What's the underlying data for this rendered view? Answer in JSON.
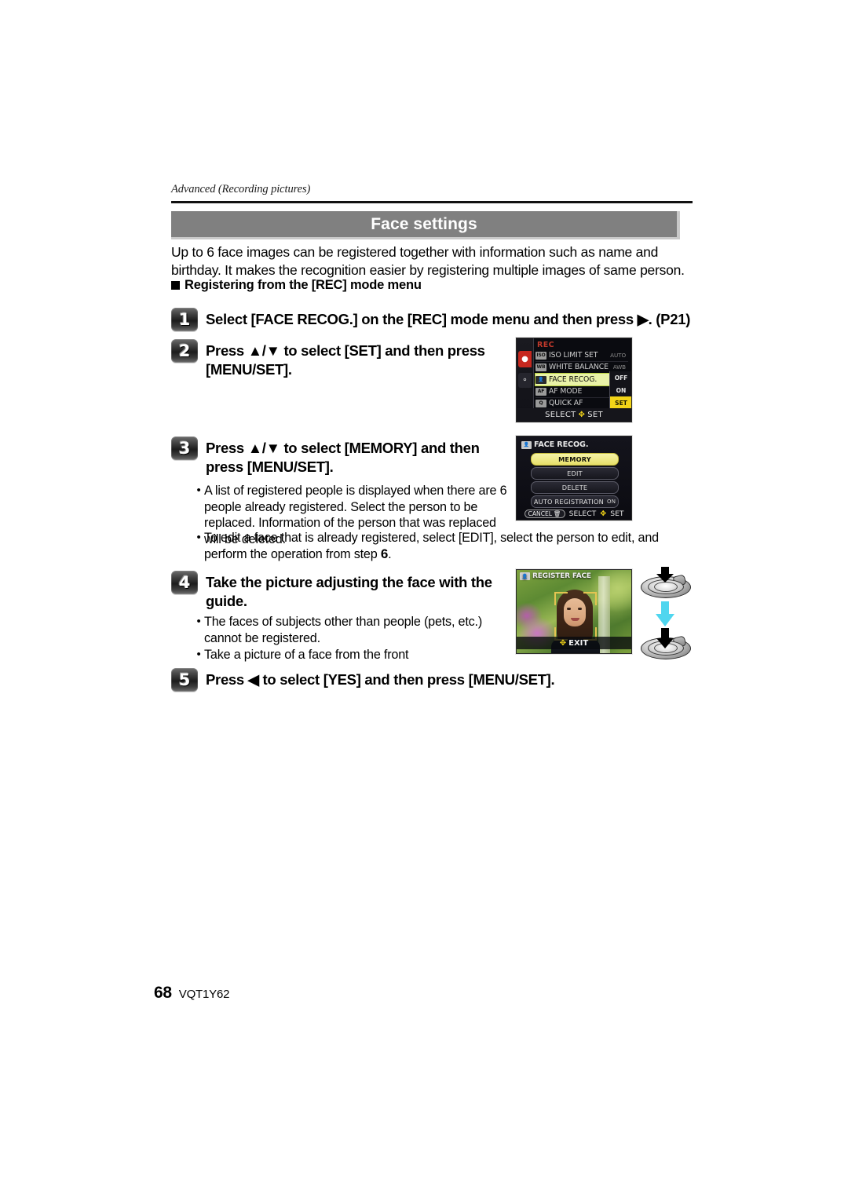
{
  "running_head": "Advanced (Recording pictures)",
  "section": {
    "title": "Face settings",
    "banner_color": "#808080",
    "intro": "Up to 6 face images can be registered together with information such as name and birthday. It makes the recognition easier by registering multiple images of same person.",
    "subhead": "Registering from the [REC] mode menu"
  },
  "steps": [
    {
      "number": "1",
      "text": "Select [FACE RECOG.] on the [REC] mode menu and then press ▶.  (P21)"
    },
    {
      "number": "2",
      "text": "Press ▲/▼ to select [SET] and then press [MENU/SET]."
    },
    {
      "number": "3",
      "text": "Press ▲/▼ to select [MEMORY] and then press [MENU/SET]."
    },
    {
      "number": "4",
      "text": "Take the picture adjusting the face with the guide."
    },
    {
      "number": "5",
      "text": "Press ◀ to select [YES] and then press [MENU/SET]."
    }
  ],
  "bullets_step3": [
    "A list of registered people is displayed when there are 6 people already registered. Select the person to be replaced. Information of the person that was replaced will be deleted.",
    "To edit a face that is already registered, select [EDIT], select the person to edit, and perform the operation from step "
  ],
  "bullets_step3_ref": "6",
  "bullets_step3_suffix": ".",
  "bullets_step4": [
    "The faces of subjects other than people (pets, etc.) cannot be registered.",
    "Take a picture of a face from the front"
  ],
  "lcd_rec_menu": {
    "mode_label": "REC",
    "tab_rec_icon": "camera-icon",
    "tab_setup_icon": "wrench-icon",
    "rows": [
      {
        "icon": "iso-icon",
        "name": "ISO LIMIT SET",
        "value": "AUTO"
      },
      {
        "icon": "wb-icon",
        "name": "WHITE BALANCE",
        "value": "AWB"
      },
      {
        "icon": "face-icon",
        "name": "FACE RECOG.",
        "value": "",
        "selected": true
      },
      {
        "icon": "af-icon",
        "name": "AF MODE",
        "value": ""
      },
      {
        "icon": "quick-icon",
        "name": "QUICK AF",
        "value": ""
      }
    ],
    "options": [
      {
        "label": "OFF",
        "selected": false
      },
      {
        "label": "ON",
        "selected": false
      },
      {
        "label": "SET",
        "selected": true
      }
    ],
    "footer_left": "SELECT",
    "footer_right": "SET",
    "footer_icon": "joystick-icon"
  },
  "lcd_face_recog": {
    "header": "FACE RECOG.",
    "header_icon": "face-icon",
    "buttons": [
      {
        "label": "MEMORY",
        "selected": true
      },
      {
        "label": "EDIT",
        "selected": false
      },
      {
        "label": "DELETE",
        "selected": false
      },
      {
        "label": "AUTO REGISTRATION",
        "flag": "ON",
        "selected": false
      }
    ],
    "footer_cancel": "CANCEL",
    "footer_cancel_icon": "trash-icon",
    "footer_select": "SELECT",
    "footer_set": "SET",
    "footer_icon": "joystick-icon"
  },
  "lcd_register_face": {
    "title": "REGISTER FACE",
    "title_icon": "face-icon",
    "exit_label": "EXIT",
    "exit_icon": "joystick-icon",
    "guide_color": "#e4c451"
  },
  "shutter_graphic": {
    "top_icon": "shutter-button-half-press-icon",
    "arrow_icon": "down-arrow-icon",
    "arrow_color": "#4fd6ef",
    "bottom_icon": "shutter-button-full-press-icon"
  },
  "footer": {
    "page_number": "68",
    "document_id": "VQT1Y62"
  }
}
